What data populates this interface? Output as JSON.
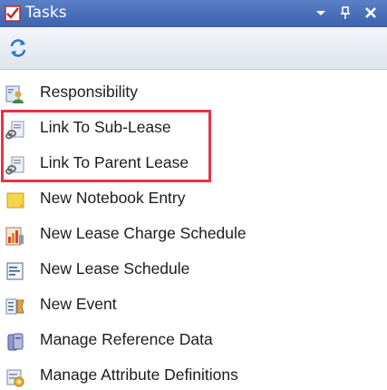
{
  "window": {
    "title": "Tasks",
    "icons": [
      "tasks-app-icon",
      "dropdown-icon",
      "pin-icon",
      "close-icon"
    ]
  },
  "toolbar": {
    "icons": [
      "refresh-icon"
    ]
  },
  "tasks": {
    "items": [
      {
        "label": "Responsibility",
        "icon": "responsibility-icon"
      },
      {
        "label": "Link To Sub-Lease",
        "icon": "link-lease-icon"
      },
      {
        "label": "Link To Parent Lease",
        "icon": "link-lease-icon"
      },
      {
        "label": "New Notebook Entry",
        "icon": "notebook-icon"
      },
      {
        "label": "New Lease Charge Schedule",
        "icon": "charge-schedule-icon"
      },
      {
        "label": "New Lease Schedule",
        "icon": "schedule-icon"
      },
      {
        "label": "New Event",
        "icon": "event-icon"
      },
      {
        "label": "Manage Reference Data",
        "icon": "reference-data-icon"
      },
      {
        "label": "Manage Attribute Definitions",
        "icon": "attribute-definitions-icon"
      }
    ]
  },
  "highlight": {
    "color": "#e8333f"
  }
}
